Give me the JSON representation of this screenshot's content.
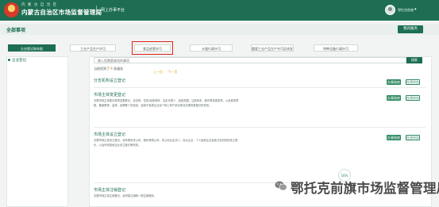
{
  "header": {
    "site_sub": "内 蒙 古 自 治 区",
    "site_title": "内蒙古自治区市场监督管理局",
    "platform": "网上办事平台",
    "user_name": "鄂托克前旗"
  },
  "page": {
    "title": "全部事项",
    "my_services": "我的服务"
  },
  "tabs": [
    {
      "label": "企业登记和年报",
      "active": true
    },
    {
      "label": "工业产品生产许可",
      "active": false
    },
    {
      "label": "食品经营许可",
      "active": false
    },
    {
      "label": "计量行政许可",
      "active": false
    },
    {
      "label": "重要工业产品生产许可证核发",
      "active": false
    },
    {
      "label": "特种设备行政许可",
      "active": false
    }
  ],
  "leftnav": {
    "item": "企业登记"
  },
  "search": {
    "placeholder": "输入您需要查找的事项",
    "button": "搜索"
  },
  "results": {
    "prefix": "当前找到了",
    "count": "6",
    "suffix": "条服务",
    "pager_prev": "上一页",
    "pager_next": "下一页"
  },
  "category_title": "分支机构设立登记",
  "buttons": {
    "guide": "办事指南",
    "apply": "在线申办"
  },
  "services": [
    {
      "title": "市场主体变更登记",
      "desc": "办理市场主体登记事项变更登记，含名称、住所/经营场所、法定代表人、经营范围、注册资本、股东等变更事项，以及修改章程、备案董事、监事、经理等人员信息，适用于各类企业及个体工商户依法申请办理变更登记的情形。"
    },
    {
      "title": "市场主体设立登记",
      "desc": "办理市场主体设立登记，含有限责任公司、股份有限公司、非公司企业法人、合伙企业、个人独资企业及其分支机构的设立登记，以及外商投资企业设立登记等情形。"
    },
    {
      "title": "市场主体注销登记",
      "desc": "办理市场主体注销登记，含简易注销和一般注销程序。"
    }
  ],
  "float_bubble": "56%"
}
